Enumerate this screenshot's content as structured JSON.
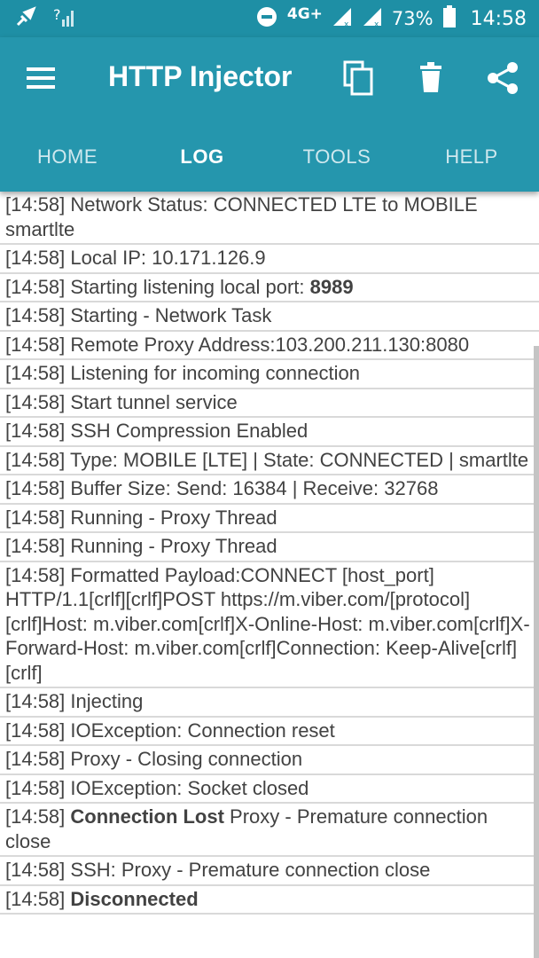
{
  "status_bar": {
    "network_label": "4G+",
    "battery": "73%",
    "time": "14:58",
    "icons": [
      "usb-debug-icon",
      "no-signal-icon",
      "dnd-icon",
      "signal-icon",
      "signal-icon",
      "battery-icon"
    ]
  },
  "toolbar": {
    "title": "HTTP Injector",
    "actions": [
      "copy-icon",
      "delete-icon",
      "share-icon"
    ]
  },
  "tabs": [
    {
      "label": "HOME",
      "active": false
    },
    {
      "label": "LOG",
      "active": true
    },
    {
      "label": "TOOLS",
      "active": false
    },
    {
      "label": "HELP",
      "active": false
    }
  ],
  "log": [
    {
      "time": "[14:58]",
      "bold": "",
      "text": " Network Status: CONNECTED LTE to MOBILE smartlte"
    },
    {
      "time": "[14:58]",
      "bold": "",
      "text": " Local IP: 10.171.126.9"
    },
    {
      "time": "[14:58]",
      "bold": "",
      "text": " Starting listening local port: ",
      "bold_after": "8989"
    },
    {
      "time": "[14:58]",
      "bold": "",
      "text": " Starting - Network Task"
    },
    {
      "time": "[14:58]",
      "bold": "",
      "text": " Remote Proxy Address:103.200.211.130:8080"
    },
    {
      "time": "[14:58]",
      "bold": "",
      "text": " Listening for incoming connection"
    },
    {
      "time": "[14:58]",
      "bold": "",
      "text": " Start tunnel service"
    },
    {
      "time": "[14:58]",
      "bold": "",
      "text": " SSH Compression Enabled"
    },
    {
      "time": "[14:58]",
      "bold": "",
      "text": " Type: MOBILE [LTE] | State: CONNECTED | smartlte"
    },
    {
      "time": "[14:58]",
      "bold": "",
      "text": " Buffer Size: Send: 16384 | Receive: 32768"
    },
    {
      "time": "[14:58]",
      "bold": "",
      "text": " Running - Proxy Thread"
    },
    {
      "time": "[14:58]",
      "bold": "",
      "text": " Running - Proxy Thread"
    },
    {
      "time": "[14:58]",
      "bold": "",
      "text": " Formatted Payload:CONNECT [host_port] HTTP/1.1[crlf][crlf]POST https://m.viber.com/[protocol][crlf]Host: m.viber.com[crlf]X-Online-Host: m.viber.com[crlf]X-Forward-Host: m.viber.com[crlf]Connection: Keep-Alive[crlf][crlf]"
    },
    {
      "time": "[14:58]",
      "bold": "",
      "text": " Injecting"
    },
    {
      "time": "[14:58]",
      "bold": "",
      "text": " IOException: Connection reset"
    },
    {
      "time": "[14:58]",
      "bold": "",
      "text": " Proxy - Closing connection"
    },
    {
      "time": "[14:58]",
      "bold": "",
      "text": " IOException: Socket closed"
    },
    {
      "time": "[14:58]",
      "bold": " Connection Lost",
      "text": " Proxy - Premature connection close"
    },
    {
      "time": "[14:58]",
      "bold": "",
      "text": " SSH: Proxy - Premature connection close"
    },
    {
      "time": "[14:58]",
      "bold": " Disconnected",
      "text": ""
    }
  ]
}
